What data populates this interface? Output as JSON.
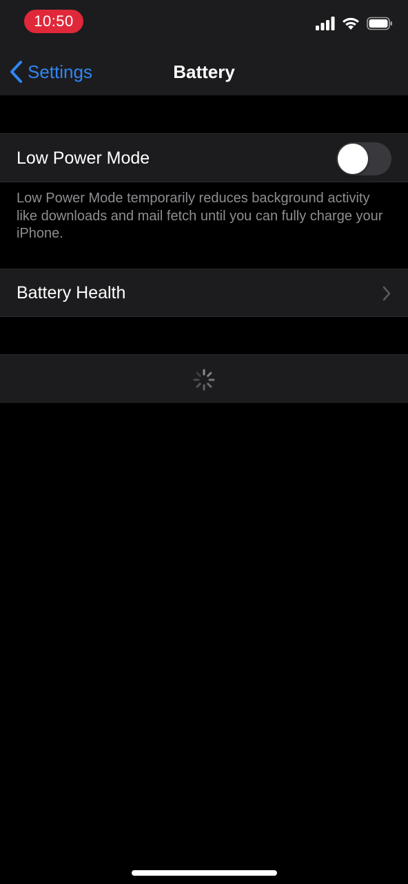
{
  "status_bar": {
    "time": "10:50",
    "icons": [
      "cellular-signal-icon",
      "wifi-icon",
      "battery-icon"
    ],
    "time_pill_color": "#e0283a"
  },
  "nav": {
    "back_label": "Settings",
    "title": "Battery",
    "accent_color": "#2f86f5"
  },
  "low_power": {
    "label": "Low Power Mode",
    "enabled": false,
    "footer": "Low Power Mode temporarily reduces background activity like downloads and mail fetch until you can fully charge your iPhone."
  },
  "battery_health": {
    "label": "Battery Health",
    "icon": "chevron-right-icon"
  },
  "loading": {
    "icon": "spinner-icon"
  }
}
